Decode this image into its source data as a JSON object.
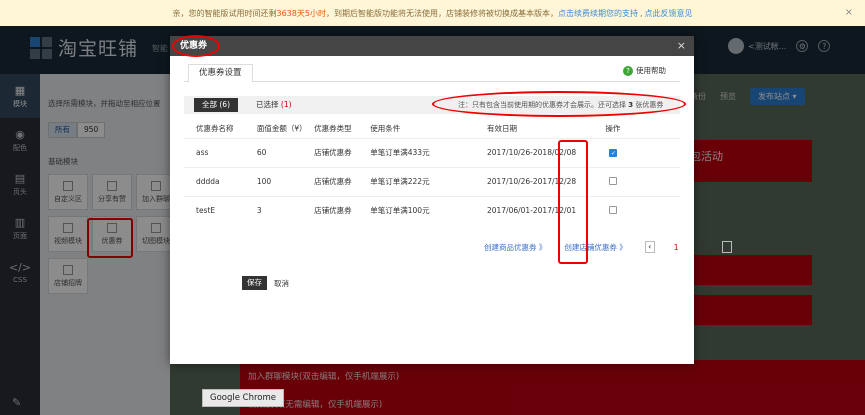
{
  "notice": {
    "pre": "亲，您的智能版试用时间还剩",
    "highlight": "3638天5小时",
    "mid": "，到期后智能版功能将无法使用，店铺装修将被切换成基本版本，",
    "link": "点击续费续期您的支持",
    "link2": "点此反馈意见"
  },
  "header": {
    "brand": "淘宝旺铺",
    "sub": "智能",
    "user": "<测试帐...",
    "toolbar": {
      "backup": "备份",
      "preview": "预览",
      "publish": "发布站点 ▾"
    }
  },
  "rail": {
    "items": [
      {
        "icon": "▦",
        "label": "模块"
      },
      {
        "icon": "◉",
        "label": "配色"
      },
      {
        "icon": "▤",
        "label": "页头"
      },
      {
        "icon": "▥",
        "label": "页面"
      },
      {
        "icon": "</>",
        "label": "CSS"
      }
    ],
    "edit_icon": "✎"
  },
  "modules": {
    "tip": "选择所需模块，并拖动至相应位置",
    "tabs": [
      {
        "label": "所有"
      },
      {
        "label": "950"
      }
    ],
    "section": "基础模块",
    "items": [
      {
        "label": "自定义区"
      },
      {
        "label": "分享有赞"
      },
      {
        "label": "加入群聊"
      },
      {
        "label": "视频模块"
      },
      {
        "label": "优惠券"
      },
      {
        "label": "切图模块"
      },
      {
        "label": "店铺招牌"
      }
    ]
  },
  "canvas": {
    "title_fragment": "包活动",
    "text1": "加入群聊模块(双击编辑，仅手机端展示)",
    "text2": "视频模块(无需编辑，仅手机端展示)"
  },
  "modal": {
    "title": "优惠券",
    "close": "×",
    "tab": "优惠券设置",
    "help": "使用帮助",
    "filter": {
      "all_label": "全部 (6)",
      "selected_label": "已选择",
      "selected_count": "(1)",
      "note_pre": "注：只有包含当前使用期的优惠券才会展示。还可选择",
      "note_num": "3",
      "note_post": "张优惠券"
    },
    "columns": [
      "优惠券名称",
      "面值金额（¥）",
      "优惠券类型",
      "使用条件",
      "有效日期",
      "操作"
    ],
    "rows": [
      {
        "name": "ass",
        "amount": "60",
        "type": "店铺优惠券",
        "condition": "单笔订单满433元",
        "date": "2017/10/26-2018/02/08",
        "checked": true
      },
      {
        "name": "dddda",
        "amount": "100",
        "type": "店铺优惠券",
        "condition": "单笔订单满222元",
        "date": "2017/10/26-2017/12/28",
        "checked": false
      },
      {
        "name": "testE",
        "amount": "3",
        "type": "店铺优惠券",
        "condition": "单笔订单满100元",
        "date": "2017/06/01-2017/12/01",
        "checked": false
      }
    ],
    "create_item_coupon": "创建商品优惠券 》",
    "create_shop_coupon": "创建店铺优惠券 》",
    "pager": {
      "prev": "‹",
      "next": "›",
      "pages": [
        "1",
        "2"
      ]
    },
    "save": "保存",
    "cancel": "取消"
  },
  "tooltip": "Google Chrome"
}
